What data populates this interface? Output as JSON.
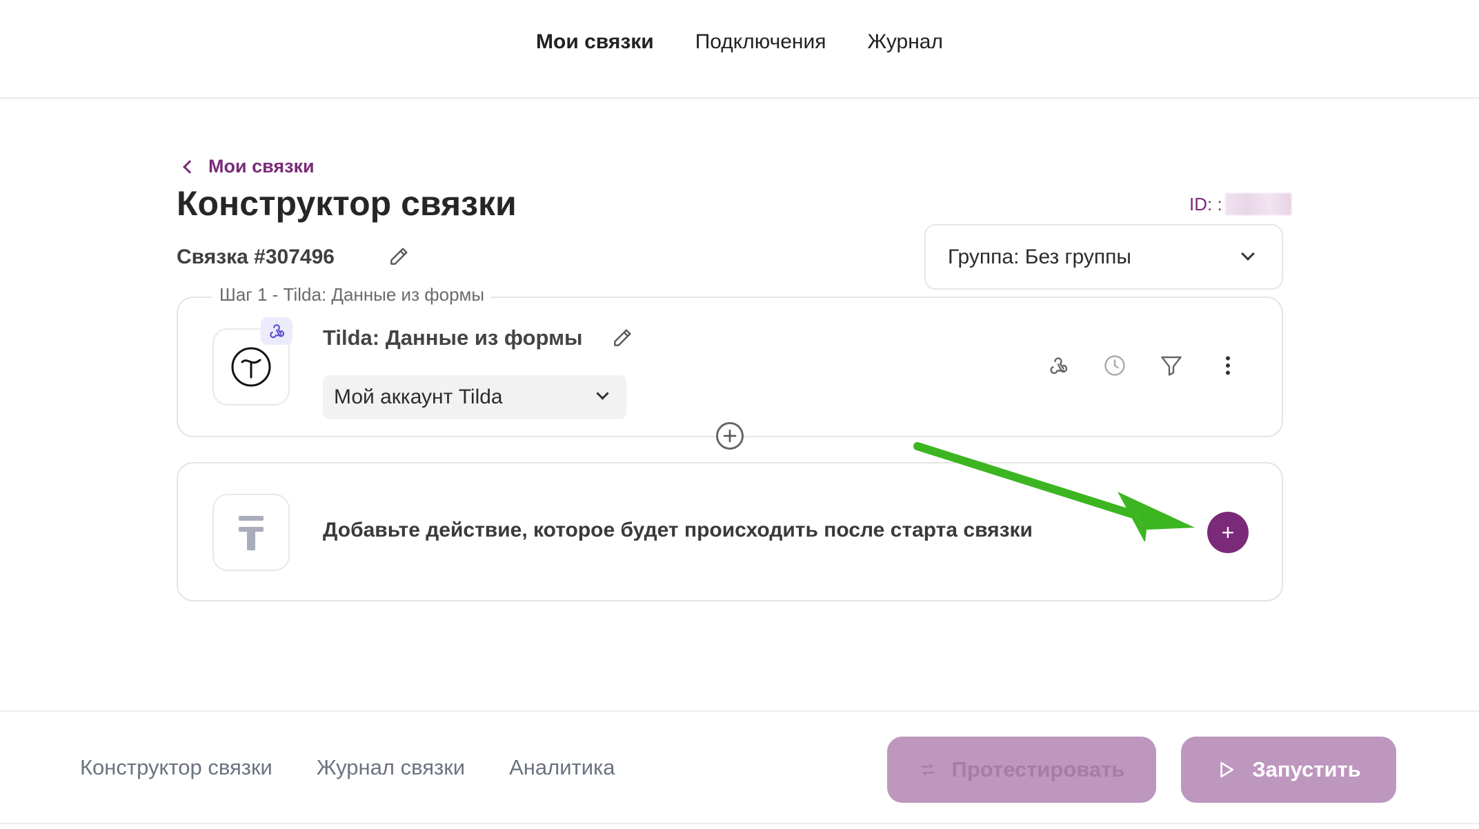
{
  "top_nav": {
    "items": [
      "Мои связки",
      "Подключения",
      "Журнал"
    ]
  },
  "breadcrumb": {
    "back_label": "Мои связки"
  },
  "page": {
    "title": "Конструктор связки",
    "id_label": "ID: :",
    "link_name": "Связка #307496"
  },
  "group_select": {
    "value": "Группа: Без группы"
  },
  "step1": {
    "legend": "Шаг 1 - Tilda: Данные из формы",
    "title": "Tilda: Данные из формы",
    "account": "Мой аккаунт Tilda"
  },
  "action_card": {
    "text": "Добавьте действие, которое будет происходить после старта связки",
    "add_symbol": "+"
  },
  "bottom_nav": {
    "items": [
      "Конструктор связки",
      "Журнал связки",
      "Аналитика"
    ]
  },
  "buttons": {
    "test_label": "Протестировать",
    "run_label": "Запустить"
  },
  "colors": {
    "accent": "#7a2a78",
    "button_disabled": "#bd97be",
    "arrow": "#3cb521"
  },
  "icons": [
    "chevron-left-icon",
    "pencil-icon",
    "chevron-down-icon",
    "webhook-icon",
    "clock-icon",
    "filter-icon",
    "more-vertical-icon",
    "plus-circle-icon",
    "tilda-logo-icon",
    "action-placeholder-icon",
    "swap-icon",
    "play-icon"
  ]
}
